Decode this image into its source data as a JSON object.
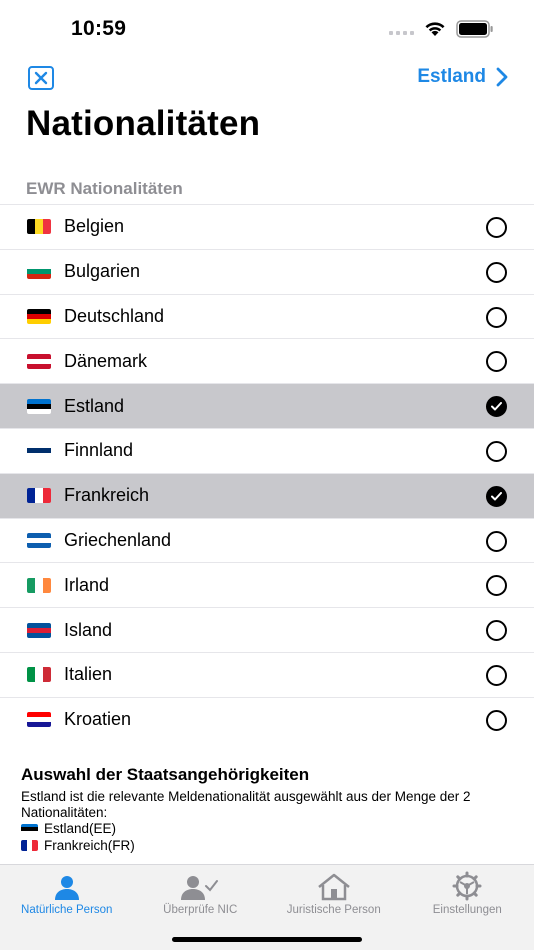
{
  "status": {
    "time": "10:59"
  },
  "nav": {
    "right_label": "Estland"
  },
  "page_title": "Nationalitäten",
  "section_title": "EWR Nationalitäten",
  "countries": [
    {
      "name": "Belgien",
      "selected": false,
      "flag": [
        "#000000",
        "#fdda24",
        "#ef3340"
      ],
      "dir": "v"
    },
    {
      "name": "Bulgarien",
      "selected": false,
      "flag": [
        "#ffffff",
        "#00966e",
        "#d62612"
      ],
      "dir": "h"
    },
    {
      "name": "Deutschland",
      "selected": false,
      "flag": [
        "#000000",
        "#dd0000",
        "#ffce00"
      ],
      "dir": "h"
    },
    {
      "name": "Dänemark",
      "selected": false,
      "flag": [
        "#c8102e",
        "#ffffff",
        "#c8102e"
      ],
      "dir": "h"
    },
    {
      "name": "Estland",
      "selected": true,
      "flag": [
        "#0072ce",
        "#000000",
        "#ffffff"
      ],
      "dir": "h"
    },
    {
      "name": "Finnland",
      "selected": false,
      "flag": [
        "#ffffff",
        "#002f6c",
        "#ffffff"
      ],
      "dir": "h"
    },
    {
      "name": "Frankreich",
      "selected": true,
      "flag": [
        "#002395",
        "#ffffff",
        "#ed2939"
      ],
      "dir": "v"
    },
    {
      "name": "Griechenland",
      "selected": false,
      "flag": [
        "#0d5eaf",
        "#ffffff",
        "#0d5eaf"
      ],
      "dir": "h"
    },
    {
      "name": "Irland",
      "selected": false,
      "flag": [
        "#169b62",
        "#ffffff",
        "#ff883e"
      ],
      "dir": "v"
    },
    {
      "name": "Island",
      "selected": false,
      "flag": [
        "#02529c",
        "#dc1e35",
        "#02529c"
      ],
      "dir": "h"
    },
    {
      "name": "Italien",
      "selected": false,
      "flag": [
        "#009246",
        "#ffffff",
        "#ce2b37"
      ],
      "dir": "v"
    },
    {
      "name": "Kroatien",
      "selected": false,
      "flag": [
        "#ff0000",
        "#ffffff",
        "#171796"
      ],
      "dir": "h"
    }
  ],
  "footer": {
    "title": "Auswahl der Staatsangehörigkeiten",
    "text": "Estland ist die relevante Meldenationalität ausgewählt aus der Menge der 2 Nationalitäten:",
    "items": [
      {
        "label": "Estland(EE)",
        "flag": [
          "#0072ce",
          "#000000",
          "#ffffff"
        ],
        "dir": "h"
      },
      {
        "label": "Frankreich(FR)",
        "flag": [
          "#002395",
          "#ffffff",
          "#ed2939"
        ],
        "dir": "v"
      }
    ]
  },
  "tabs": [
    {
      "label": "Natürliche Person",
      "icon": "person-icon",
      "active": true
    },
    {
      "label": "Überprüfe NIC",
      "icon": "person-check-icon",
      "active": false
    },
    {
      "label": "Juristische Person",
      "icon": "house-icon",
      "active": false
    },
    {
      "label": "Einstellungen",
      "icon": "gear-icon",
      "active": false
    }
  ],
  "colors": {
    "accent": "#1e88e5",
    "selected_row": "#c8c8cc",
    "inactive_tab": "#8e8e93"
  }
}
